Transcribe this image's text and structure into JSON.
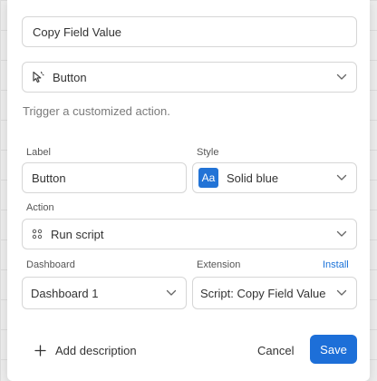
{
  "name_field": {
    "value": "Copy Field Value"
  },
  "type_select": {
    "value": "Button",
    "icon": "cursor-icon"
  },
  "description": "Trigger a customized action.",
  "label_field": {
    "label": "Label",
    "value": "Button"
  },
  "style_select": {
    "label": "Style",
    "badge": "Aa",
    "value": "Solid blue",
    "badge_color": "#2273d6"
  },
  "action_select": {
    "label": "Action",
    "value": "Run script",
    "icon": "script-icon"
  },
  "dashboard_select": {
    "label": "Dashboard",
    "value": "Dashboard 1"
  },
  "extension_select": {
    "label": "Extension",
    "value": "Script: Copy Field Value",
    "install_link": "Install"
  },
  "footer": {
    "add_description": "Add description",
    "cancel": "Cancel",
    "save": "Save",
    "accent": "#1d6fd8"
  }
}
